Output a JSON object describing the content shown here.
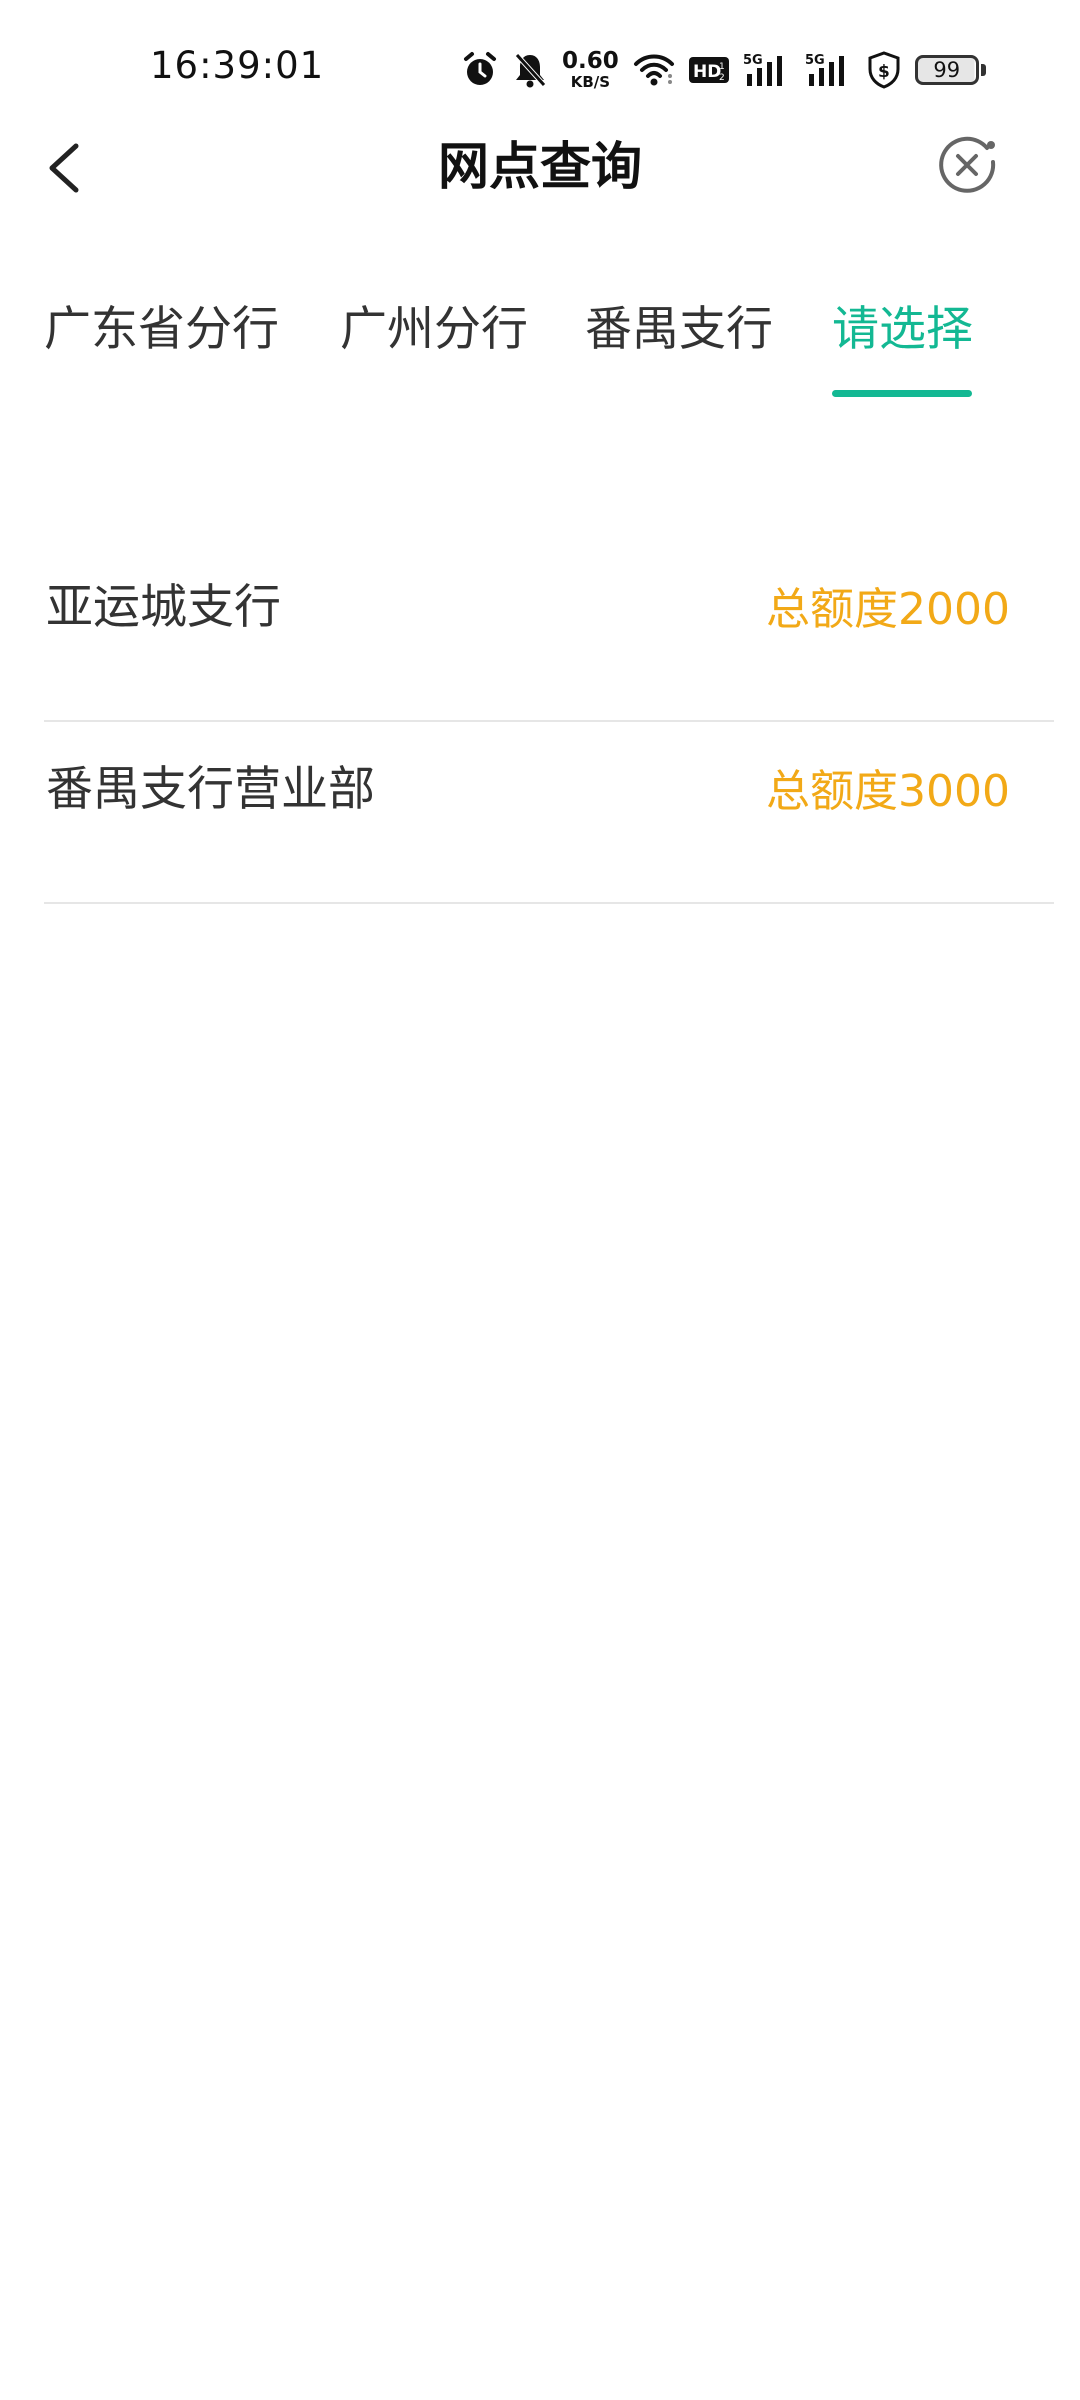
{
  "status_bar": {
    "time": "16:39:01",
    "net_speed_value": "0.60",
    "net_speed_unit": "KB/S",
    "hd_label": "HD",
    "signal_1_label": "5G",
    "signal_2_label": "5G",
    "battery_level": "99",
    "icons": [
      "alarm-icon",
      "bell-off-icon",
      "wifi-icon",
      "hd-voice-icon",
      "signal-5g-icon",
      "signal-5g-icon",
      "shield-dollar-icon",
      "battery-icon"
    ]
  },
  "header": {
    "title": "网点查询",
    "back_icon": "chevron-left-icon",
    "close_icon": "close-circle-icon"
  },
  "tabs": [
    {
      "label": "广东省分行",
      "active": false
    },
    {
      "label": "广州分行",
      "active": false
    },
    {
      "label": "番禺支行",
      "active": false
    },
    {
      "label": "请选择",
      "active": true
    }
  ],
  "branches": [
    {
      "name": "亚运城支行",
      "quota": "总额度2000"
    },
    {
      "name": "番禺支行营业部",
      "quota": "总额度3000"
    }
  ],
  "colors": {
    "accent": "#13b893",
    "quota": "#f2a917",
    "text": "#333333",
    "divider": "#e6e6e6"
  }
}
